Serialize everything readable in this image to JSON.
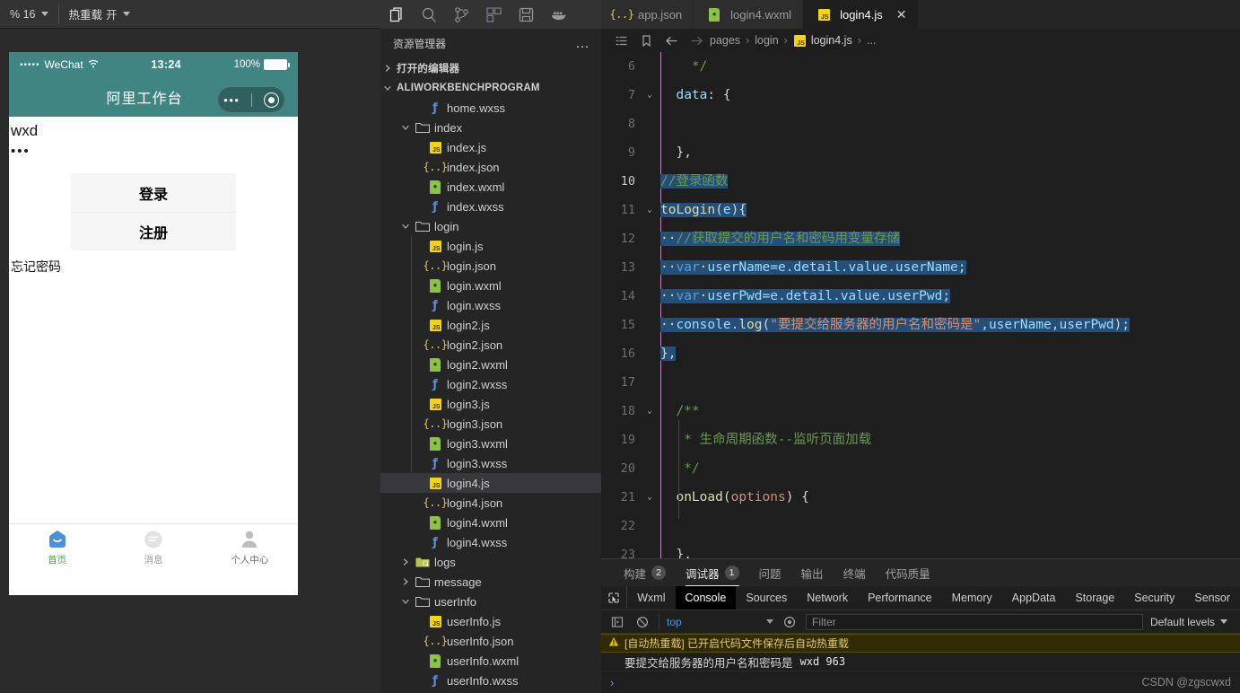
{
  "toolbar": {
    "items": [
      {
        "label": "% 16",
        "name": "scale-selector",
        "caret": true
      },
      {
        "label": "热重载",
        "value": "开",
        "name": "hot-reload-toggle",
        "caret": true
      }
    ],
    "icons": [
      {
        "name": "refresh-icon",
        "title": "编译"
      },
      {
        "name": "record-icon",
        "title": "真机调试"
      },
      {
        "name": "preview-icon",
        "title": "预览"
      },
      {
        "name": "split-icon",
        "title": "切换窗口"
      }
    ]
  },
  "simulator": {
    "status": {
      "carrier": "WeChat",
      "signal_dots": "•••••",
      "wifi": "wifi-icon",
      "time": "13:24",
      "battery_pct": "100%"
    },
    "nav": {
      "title": "阿里工作台",
      "capsule_dots": "•••"
    },
    "form": {
      "username_value": "wxd",
      "password_value": "•••",
      "login_button": "登录",
      "register_button": "注册",
      "forgot_link": "忘记密码"
    },
    "tabbar": [
      {
        "label": "首页",
        "icon": "home-icon",
        "active": true,
        "color": "#4c9f4c"
      },
      {
        "label": "消息",
        "icon": "message-icon",
        "active": false,
        "color": "#9a9a9a"
      },
      {
        "label": "个人中心",
        "icon": "user-icon",
        "active": false,
        "color": "#6d6d6d"
      }
    ]
  },
  "activity_bar": {
    "icons": [
      {
        "name": "explorer-icon",
        "active": true
      },
      {
        "name": "search-icon",
        "active": false
      },
      {
        "name": "source-control-icon",
        "active": false
      },
      {
        "name": "extensions-icon",
        "active": false
      },
      {
        "name": "save-all-icon",
        "active": false
      },
      {
        "name": "docker-icon",
        "active": false
      },
      {
        "name": "collapse-sidebar-icon",
        "active": false
      }
    ]
  },
  "explorer": {
    "title": "资源管理器",
    "more_label": "…",
    "sections": [
      {
        "label": "打开的编辑器",
        "expanded": false
      },
      {
        "label": "ALIWORKBENCHPROGRAM",
        "expanded": true
      }
    ],
    "tree": [
      {
        "label": "home.wxss",
        "kind": "wxss",
        "depth": 3,
        "type": "file"
      },
      {
        "label": "index",
        "kind": "folder",
        "depth": 2,
        "type": "folder",
        "expanded": true
      },
      {
        "label": "index.js",
        "kind": "js",
        "depth": 3,
        "type": "file"
      },
      {
        "label": "index.json",
        "kind": "json",
        "depth": 3,
        "type": "file"
      },
      {
        "label": "index.wxml",
        "kind": "wxml",
        "depth": 3,
        "type": "file"
      },
      {
        "label": "index.wxss",
        "kind": "wxss",
        "depth": 3,
        "type": "file"
      },
      {
        "label": "login",
        "kind": "folder",
        "depth": 2,
        "type": "folder",
        "expanded": true
      },
      {
        "label": "login.js",
        "kind": "js",
        "depth": 3,
        "type": "file"
      },
      {
        "label": "login.json",
        "kind": "json",
        "depth": 3,
        "type": "file"
      },
      {
        "label": "login.wxml",
        "kind": "wxml",
        "depth": 3,
        "type": "file"
      },
      {
        "label": "login.wxss",
        "kind": "wxss",
        "depth": 3,
        "type": "file"
      },
      {
        "label": "login2.js",
        "kind": "js",
        "depth": 3,
        "type": "file"
      },
      {
        "label": "login2.json",
        "kind": "json",
        "depth": 3,
        "type": "file"
      },
      {
        "label": "login2.wxml",
        "kind": "wxml",
        "depth": 3,
        "type": "file"
      },
      {
        "label": "login2.wxss",
        "kind": "wxss",
        "depth": 3,
        "type": "file"
      },
      {
        "label": "login3.js",
        "kind": "js",
        "depth": 3,
        "type": "file"
      },
      {
        "label": "login3.json",
        "kind": "json",
        "depth": 3,
        "type": "file"
      },
      {
        "label": "login3.wxml",
        "kind": "wxml",
        "depth": 3,
        "type": "file"
      },
      {
        "label": "login3.wxss",
        "kind": "wxss",
        "depth": 3,
        "type": "file"
      },
      {
        "label": "login4.js",
        "kind": "js",
        "depth": 3,
        "type": "file",
        "selected": true
      },
      {
        "label": "login4.json",
        "kind": "json",
        "depth": 3,
        "type": "file"
      },
      {
        "label": "login4.wxml",
        "kind": "wxml",
        "depth": 3,
        "type": "file"
      },
      {
        "label": "login4.wxss",
        "kind": "wxss",
        "depth": 3,
        "type": "file"
      },
      {
        "label": "logs",
        "kind": "folder-log",
        "depth": 2,
        "type": "folder",
        "expanded": false
      },
      {
        "label": "message",
        "kind": "folder",
        "depth": 2,
        "type": "folder",
        "expanded": false
      },
      {
        "label": "userInfo",
        "kind": "folder",
        "depth": 2,
        "type": "folder",
        "expanded": true
      },
      {
        "label": "userInfo.js",
        "kind": "js",
        "depth": 3,
        "type": "file"
      },
      {
        "label": "userInfo.json",
        "kind": "json",
        "depth": 3,
        "type": "file"
      },
      {
        "label": "userInfo.wxml",
        "kind": "wxml",
        "depth": 3,
        "type": "file"
      },
      {
        "label": "userInfo.wxss",
        "kind": "wxss",
        "depth": 3,
        "type": "file"
      }
    ]
  },
  "editor": {
    "tabs": [
      {
        "label": "app.json",
        "kind": "json",
        "active": false,
        "closable": false
      },
      {
        "label": "login4.wxml",
        "kind": "wxml",
        "active": false,
        "closable": false
      },
      {
        "label": "login4.js",
        "kind": "js",
        "active": true,
        "closable": true,
        "close_label": "✕"
      }
    ],
    "breadcrumb": {
      "icons": [
        "outline-icon",
        "bookmark-icon",
        "back-arrow-icon",
        "forward-arrow-icon"
      ],
      "segments": [
        "pages",
        "login",
        "login4.js",
        "..."
      ],
      "separator": "›"
    },
    "lines": [
      {
        "num": "6",
        "fold": "",
        "parts": [
          {
            "t": "    ",
            "c": "t-pl"
          },
          {
            "t": "*/",
            "c": "t-com"
          }
        ]
      },
      {
        "num": "7",
        "fold": "⌄",
        "parts": [
          {
            "t": "  ",
            "c": "t-pl"
          },
          {
            "t": "data",
            "c": "t-var"
          },
          {
            "t": ": {",
            "c": "t-pl"
          }
        ]
      },
      {
        "num": "8",
        "fold": "",
        "parts": []
      },
      {
        "num": "9",
        "fold": "",
        "parts": [
          {
            "t": "  },",
            "c": "t-pl"
          }
        ]
      },
      {
        "num": "10",
        "fold": "",
        "selected": true,
        "current": true,
        "parts": [
          {
            "t": "//登录函数",
            "c": "t-com"
          }
        ]
      },
      {
        "num": "11",
        "fold": "⌄",
        "selected": true,
        "parts": [
          {
            "t": "toLogin",
            "c": "t-fn"
          },
          {
            "t": "(",
            "c": "t-par"
          },
          {
            "t": "e",
            "c": "t-var"
          },
          {
            "t": "){",
            "c": "t-par"
          }
        ]
      },
      {
        "num": "12",
        "fold": "",
        "selected": true,
        "parts": [
          {
            "t": "··",
            "c": "t-pl dim"
          },
          {
            "t": "//获取提交的用户名和密码用变量存储",
            "c": "t-com"
          }
        ]
      },
      {
        "num": "13",
        "fold": "",
        "selected": true,
        "parts": [
          {
            "t": "··",
            "c": "t-pl dim"
          },
          {
            "t": "var",
            "c": "t-kw"
          },
          {
            "t": "·",
            "c": "t-pl dim"
          },
          {
            "t": "userName=e.detail.value.userName",
            "c": "t-var"
          },
          {
            "t": ";",
            "c": "t-pl"
          }
        ]
      },
      {
        "num": "14",
        "fold": "",
        "selected": true,
        "parts": [
          {
            "t": "··",
            "c": "t-pl dim"
          },
          {
            "t": "var",
            "c": "t-kw"
          },
          {
            "t": "·",
            "c": "t-pl dim"
          },
          {
            "t": "userPwd=e.detail.value.userPwd",
            "c": "t-var"
          },
          {
            "t": ";",
            "c": "t-pl"
          }
        ]
      },
      {
        "num": "15",
        "fold": "",
        "selected": true,
        "parts": [
          {
            "t": "··",
            "c": "t-pl dim"
          },
          {
            "t": "console",
            "c": "t-var"
          },
          {
            "t": ".",
            "c": "t-pl"
          },
          {
            "t": "log",
            "c": "t-fn"
          },
          {
            "t": "(",
            "c": "t-par"
          },
          {
            "t": "\"要提交给服务器的用户名和密码是\"",
            "c": "t-str"
          },
          {
            "t": ",",
            "c": "t-pl"
          },
          {
            "t": "userName",
            "c": "t-var"
          },
          {
            "t": ",",
            "c": "t-pl"
          },
          {
            "t": "userPwd",
            "c": "t-var"
          },
          {
            "t": ")",
            "c": "t-par"
          },
          {
            "t": ";",
            "c": "t-pl"
          }
        ]
      },
      {
        "num": "16",
        "fold": "",
        "selected": true,
        "parts": [
          {
            "t": "},",
            "c": "t-pl"
          }
        ]
      },
      {
        "num": "17",
        "fold": "",
        "parts": []
      },
      {
        "num": "18",
        "fold": "⌄",
        "parts": [
          {
            "t": "  ",
            "c": "t-pl"
          },
          {
            "t": "/**",
            "c": "t-com"
          }
        ]
      },
      {
        "num": "19",
        "fold": "",
        "parts": [
          {
            "t": "   ",
            "c": "t-pl"
          },
          {
            "t": "* 生命周期函数--监听页面加载",
            "c": "t-com"
          }
        ]
      },
      {
        "num": "20",
        "fold": "",
        "parts": [
          {
            "t": "   ",
            "c": "t-pl"
          },
          {
            "t": "*/",
            "c": "t-com"
          }
        ]
      },
      {
        "num": "21",
        "fold": "⌄",
        "parts": [
          {
            "t": "  ",
            "c": "t-pl"
          },
          {
            "t": "onLoad",
            "c": "t-fn"
          },
          {
            "t": "(",
            "c": "t-par"
          },
          {
            "t": "options",
            "c": "t-or"
          },
          {
            "t": ")",
            "c": "t-par"
          },
          {
            "t": " {",
            "c": "t-pl"
          }
        ]
      },
      {
        "num": "22",
        "fold": "",
        "parts": []
      },
      {
        "num": "23",
        "fold": "",
        "parts": [
          {
            "t": "  },",
            "c": "t-pl"
          }
        ]
      }
    ]
  },
  "panel": {
    "tabs": [
      {
        "label": "构建",
        "badge": "2",
        "active": false
      },
      {
        "label": "调试器",
        "badge": "1",
        "active": true
      },
      {
        "label": "问题",
        "badge": "",
        "active": false
      },
      {
        "label": "输出",
        "badge": "",
        "active": false
      },
      {
        "label": "终端",
        "badge": "",
        "active": false
      },
      {
        "label": "代码质量",
        "badge": "",
        "active": false
      }
    ],
    "devtools_tabs": [
      {
        "label": "Wxml",
        "active": false
      },
      {
        "label": "Console",
        "active": true
      },
      {
        "label": "Sources",
        "active": false
      },
      {
        "label": "Network",
        "active": false
      },
      {
        "label": "Performance",
        "active": false
      },
      {
        "label": "Memory",
        "active": false
      },
      {
        "label": "AppData",
        "active": false
      },
      {
        "label": "Storage",
        "active": false
      },
      {
        "label": "Security",
        "active": false
      },
      {
        "label": "Sensor",
        "active": false
      }
    ],
    "filter_bar": {
      "context": "top",
      "filter_placeholder": "Filter",
      "levels": "Default levels"
    },
    "console": {
      "warning": "[自动热重载] 已开启代码文件保存后自动热重载",
      "log_message": "要提交给服务器的用户名和密码是",
      "log_values": "wxd  963",
      "prompt": "›",
      "watermark": "CSDN @zgscwxd"
    }
  },
  "colors": {
    "accent_teal": "#3f8683",
    "selection": "#264f78",
    "warn_bg": "#332b00",
    "js_yellow": "#f5d30f",
    "wxml_green": "#8dc149",
    "wxss_blue": "#5b8ddb"
  }
}
